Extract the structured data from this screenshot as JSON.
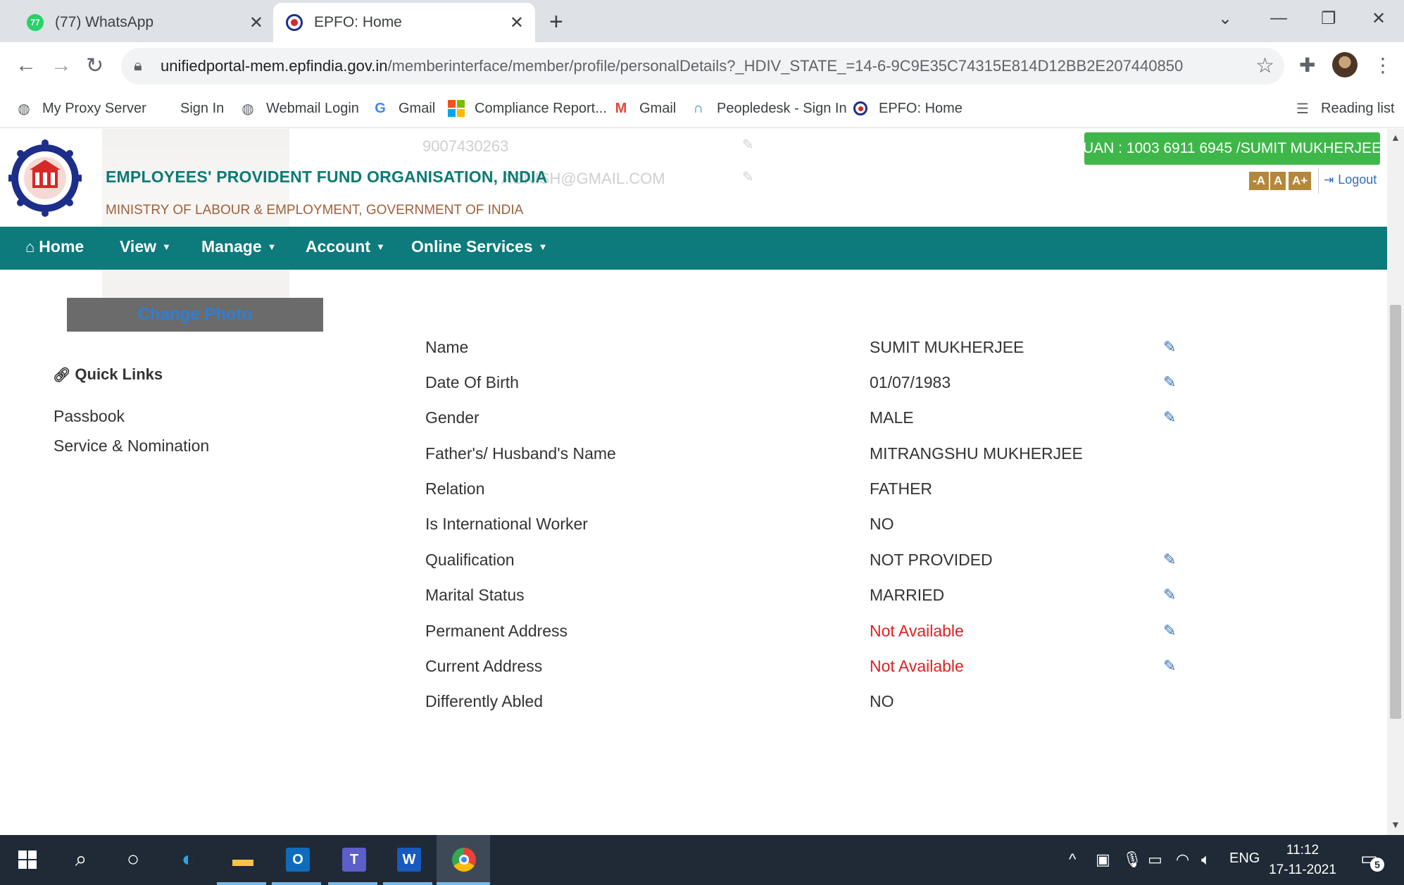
{
  "browser": {
    "tabs": [
      {
        "title": "(77) WhatsApp",
        "badge": "77",
        "active": false
      },
      {
        "title": "EPFO: Home",
        "active": true
      }
    ],
    "url": {
      "host": "unifiedportal-mem.epfindia.gov.in",
      "path": "/memberinterface/member/profile/personalDetails?_HDIV_STATE_=14-6-9C9E35C74315E814D12BB2E207440850"
    },
    "bookmarks": [
      "My Proxy Server",
      "Sign In",
      "Webmail Login",
      "Gmail",
      "Compliance Report...",
      "Gmail",
      "Peopledesk - Sign In",
      "EPFO: Home"
    ],
    "reading_list": "Reading list"
  },
  "header": {
    "org_title": "EMPLOYEES' PROVIDENT FUND ORGANISATION, INDIA",
    "org_subtitle": "MINISTRY OF LABOUR & EMPLOYMENT, GOVERNMENT OF INDIA",
    "uan": "UAN : 1003 6911 6945 /SUMIT MUKHERJEE",
    "font_buttons": [
      "-A",
      "A",
      "A+"
    ],
    "logout": "Logout",
    "ghost_phone": "9007430263",
    "ghost_email": "AGNISH@GMAIL.COM",
    "change_photo": "Change Photo"
  },
  "nav": {
    "home": "Home",
    "view": "View",
    "manage": "Manage",
    "account": "Account",
    "online_services": "Online Services"
  },
  "quick_links": {
    "title": "Quick Links",
    "items": [
      "Passbook",
      "Service & Nomination"
    ]
  },
  "details": [
    {
      "label": "Name",
      "value": "SUMIT MUKHERJEE",
      "editable": true
    },
    {
      "label": "Date Of Birth",
      "value": "01/07/1983",
      "editable": true
    },
    {
      "label": "Gender",
      "value": "MALE",
      "editable": true
    },
    {
      "label": "Father's/ Husband's Name",
      "value": "MITRANGSHU MUKHERJEE",
      "editable": false
    },
    {
      "label": "Relation",
      "value": "FATHER",
      "editable": false
    },
    {
      "label": "Is International Worker",
      "value": "NO",
      "editable": false
    },
    {
      "label": "Qualification",
      "value": "NOT PROVIDED",
      "editable": true
    },
    {
      "label": "Marital Status",
      "value": "MARRIED",
      "editable": true
    },
    {
      "label": "Permanent Address",
      "value": "Not Available",
      "editable": true,
      "status_color": "#e02020"
    },
    {
      "label": "Current Address",
      "value": "Not Available",
      "editable": true,
      "status_color": "#e02020"
    },
    {
      "label": "Differently Abled",
      "value": "NO",
      "editable": false
    }
  ],
  "taskbar": {
    "lang": "ENG",
    "time": "11:12",
    "date": "17-11-2021",
    "notifications": "5"
  },
  "colors": {
    "nav_bg": "#0d7a7c",
    "uan_bg": "#3fb64a",
    "org_title": "#0b7a74",
    "not_available": "#e02020",
    "edit_icon": "#2f6fb5"
  },
  "icons": {
    "back": "arrow-left-icon",
    "forward": "arrow-right-icon",
    "reload": "reload-icon",
    "lock": "lock-icon",
    "bookmark_star": "star-icon",
    "extensions": "puzzle-icon",
    "edit": "pencil-icon",
    "link": "link-icon",
    "home": "home-icon"
  }
}
